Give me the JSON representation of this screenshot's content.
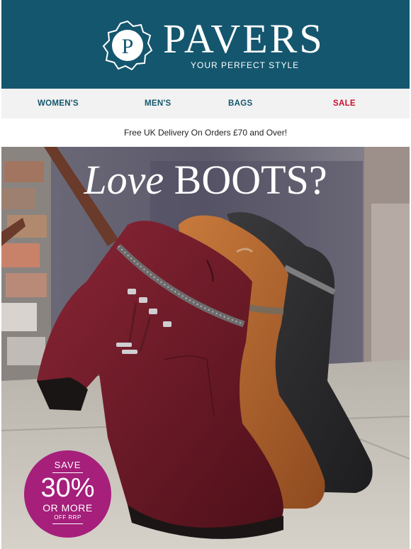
{
  "header": {
    "brand": "PAVERS",
    "tagline": "YOUR PERFECT STYLE",
    "logo_letter": "P",
    "background": "#14566e"
  },
  "nav": {
    "items": [
      {
        "label": "WOMEN'S"
      },
      {
        "label": "MEN'S"
      },
      {
        "label": "BAGS"
      },
      {
        "label": "SALE"
      }
    ],
    "color": "#14566e",
    "sale_color": "#c8102e"
  },
  "promo": {
    "text": "Free UK Delivery On Orders £70 and Over!"
  },
  "hero": {
    "headline_italic": "Love",
    "headline_caps": "BOOTS?",
    "badge": {
      "line1": "SAVE",
      "big": "30%",
      "line3": "OR MORE",
      "line4": "OFF RRP",
      "color": "#a51f7b"
    },
    "boot_colors": [
      "#6e1a2a",
      "#b8652e",
      "#2a2a2c"
    ]
  }
}
